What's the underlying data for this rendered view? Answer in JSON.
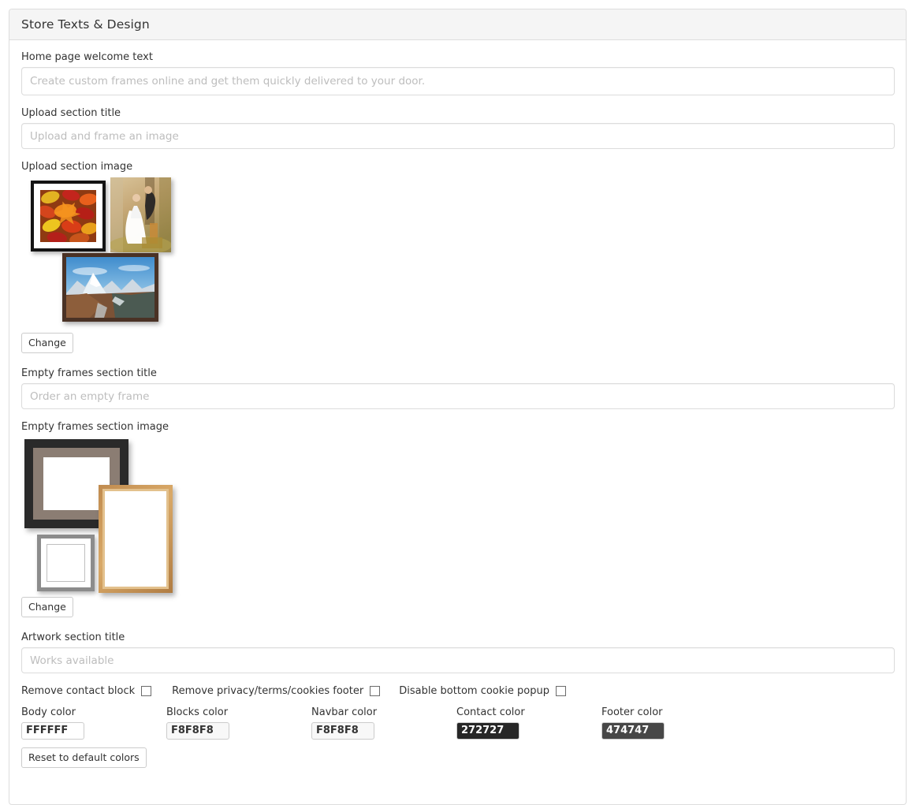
{
  "panel": {
    "title": "Store Texts & Design"
  },
  "fields": {
    "welcome": {
      "label": "Home page welcome text",
      "value": "",
      "placeholder": "Create custom frames online and get them quickly delivered to your door."
    },
    "upload_title": {
      "label": "Upload section title",
      "value": "",
      "placeholder": "Upload and frame an image"
    },
    "upload_image": {
      "label": "Upload section image",
      "change_label": "Change"
    },
    "empty_frames_title": {
      "label": "Empty frames section title",
      "value": "",
      "placeholder": "Order an empty frame"
    },
    "empty_frames_image": {
      "label": "Empty frames section image",
      "change_label": "Change"
    },
    "artwork_title": {
      "label": "Artwork section title",
      "value": "",
      "placeholder": "Works available"
    }
  },
  "checkboxes": [
    {
      "label": "Remove contact block",
      "checked": false
    },
    {
      "label": "Remove privacy/terms/cookies footer",
      "checked": false
    },
    {
      "label": "Disable bottom cookie popup",
      "checked": false
    }
  ],
  "colors": [
    {
      "label": "Body color",
      "value": "FFFFFF",
      "hex": "#FFFFFF",
      "text": "#333333"
    },
    {
      "label": "Blocks color",
      "value": "F8F8F8",
      "hex": "#F8F8F8",
      "text": "#333333"
    },
    {
      "label": "Navbar color",
      "value": "F8F8F8",
      "hex": "#F8F8F8",
      "text": "#333333"
    },
    {
      "label": "Contact color",
      "value": "272727",
      "hex": "#272727",
      "text": "#FFFFFF"
    },
    {
      "label": "Footer color",
      "value": "474747",
      "hex": "#474747",
      "text": "#FFFFFF"
    }
  ],
  "reset_button": {
    "label": "Reset to default colors"
  },
  "artwork_previews": {
    "upload_section": [
      {
        "name": "autumn-leaves-framed-photo",
        "frame": "black",
        "subject": "autumn maple leaves"
      },
      {
        "name": "wedding-canvas-print",
        "frame": "canvas-wrap",
        "subject": "bride and groom"
      },
      {
        "name": "mountain-landscape-framed-photo",
        "frame": "dark brown",
        "subject": "snowy mountains"
      }
    ],
    "empty_frames_section": [
      {
        "name": "black-frame-with-taupe-mat",
        "frame": "#2a2a2a",
        "mat": "#8b7d73"
      },
      {
        "name": "gold-ornate-frame",
        "frame": "#c08b4f",
        "mat": "none"
      },
      {
        "name": "grey-frame-small",
        "frame": "#8c8c8c",
        "mat": "#ffffff"
      }
    ]
  }
}
